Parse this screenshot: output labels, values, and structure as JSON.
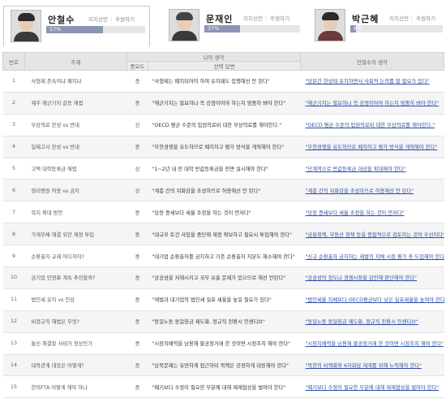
{
  "candidates": [
    {
      "name": "안철수",
      "support_btn": "지지선언",
      "donate_btn": "후원하기",
      "percent": "57%",
      "value": 0.57,
      "active": true
    },
    {
      "name": "문재인",
      "support_btn": "지지선언",
      "donate_btn": "후원하기",
      "percent": "37%",
      "value": 0.37,
      "active": false
    },
    {
      "name": "박근혜",
      "support_btn": "지지선언",
      "donate_btn": "후원하기",
      "percent": "6%",
      "value": 0.06,
      "active": false
    }
  ],
  "table": {
    "headers": {
      "no": "번호",
      "topic": "주제",
      "my_view": "나의 생각",
      "importance": "중요도",
      "answer": "선택 답변",
      "cand_view": "안철수의 생각"
    },
    "rows": [
      {
        "no": "1",
        "topic": "사형제 존속이냐 폐지냐",
        "imp": "중",
        "answer": "\"사형제는 폐지되어야 하며 유지돼도 집행해선 안 된다\"",
        "cand": "\"당분간 현상태 유지하면서 사회적 논의를 할 필요가 있다\""
      },
      {
        "no": "2",
        "topic": "제주 해군기지 갈등 해법",
        "imp": "중",
        "answer": "\"해군기지는 필요하나 꼭 강정이어야 하는지 엄중히 봐야 한다\"",
        "cand": "\"해군기지는 필요하나 꼭 강정이어야 하는지 엄중히 봐야 한다\""
      },
      {
        "no": "3",
        "topic": "무상의료 찬성 vs 반대",
        "imp": "상",
        "answer": "\"OECD 평균 수준의 입원의료비 대한 무상의료를 해야한다.\"",
        "cand": "\"OECD 평균 수준의 입원의료비 대한 무상의료를 해야한다.\""
      },
      {
        "no": "4",
        "topic": "일제고사 찬성 vs 반대",
        "imp": "중",
        "answer": "\"무한경쟁을 유도하므로 폐지하고 평가 방식을 개혁해야 한다\"",
        "cand": "\"무한경쟁을 유도하므로 폐지하고 평가 방식을 개혁해야 한다\""
      },
      {
        "no": "5",
        "topic": "고액 대학등록금 해법",
        "imp": "상",
        "answer": "\"1~2년 내 전 대학 반값등록금을 전면 실시해야 한다\"",
        "cand": "\"단계적으로 반값등록금 대상을 확대해야 한다\""
      },
      {
        "no": "6",
        "topic": "영리병원 허용 vs 금지",
        "imp": "상",
        "answer": "\"계층 간의 위화감을 조성하므로 허용해선 안 된다\"",
        "cand": "\"계층 간의 위화감을 조성하므로 허용해선 안 된다\""
      },
      {
        "no": "7",
        "topic": "복지 확대 방안",
        "imp": "중",
        "answer": "\"당장 증세보다 세율 조정을 하는 것이 먼저다\"",
        "cand": "\"당장 증세보다 세율 조정을 하는 것이 먼저다\""
      },
      {
        "no": "8",
        "topic": "가계부채 해결 위한 재정 투입",
        "imp": "중",
        "answer": "\"대규모 토건 사업을 중단해 재정 확보하고 필요시 투입해야 한다\"",
        "cand": "\"금융정책, 부동산 정책 등을 종합적으로 검토하는 것이 우선이다\""
      },
      {
        "no": "9",
        "topic": "순환출자 규제 어디까지?",
        "imp": "중",
        "answer": "\"대기업 순환출자를 금지하고 기존 순환출자 지분도 해소해야 한다\"",
        "cand": "\"신규 순환출자 금지하는 제벌의 지배 시점 평가 후 도입해야 한다\""
      },
      {
        "no": "10",
        "topic": "공기업 민영화 계속 추진할까?",
        "imp": "중",
        "answer": "\"공공성을 저해시키고 국부 유출 문제가 있으므로 해선 안된다\"",
        "cand": "\"공공성의 정도나 경쟁시장을 감안해 판단해야 한다\""
      },
      {
        "no": "11",
        "topic": "법인세 유지 vs 인상",
        "imp": "중",
        "answer": "\"재벌과 대기업의 법인세 실효 세율을 높일 필요가 있다\"",
        "cand": "\"법인세율 지체보다 OECD평균보다 낮은 실효세율을 높여야 한다\""
      },
      {
        "no": "12",
        "topic": "비정규직 해법은 무엇?",
        "imp": "중",
        "answer": "\"동일노동 동일임금 제도화, 정규직 전환시 인센티브\"",
        "cand": "\"동일노동 동일임금 제도화, 정규직 전환시 인센티브\""
      },
      {
        "no": "13",
        "topic": "통신 해결할 사태가 정상인가",
        "imp": "중",
        "answer": "\"시장지배력을 남용해 불공정거래 한 것이면 시정조치 해야 한다\"",
        "cand": "\"시장지배력을 남용해 불공정거래 한 것이면 시정조치 해야 한다\""
      },
      {
        "no": "14",
        "topic": "대북관계 대응은 어떻게?",
        "imp": "중",
        "answer": "\"남북문제는 유연하게 접근하되 북핵은 강경하게 대응해야 한다\"",
        "cand": "\"북한의 비핵화와 6자회담 재개를 위해 노력해야 한다\""
      },
      {
        "no": "15",
        "topic": "한미FTA 어떻게 해야 하나",
        "imp": "중",
        "answer": "\"폐기보다 수정이 필요한 부분에 대해 재재협상을 벌여야 한다\"",
        "cand": "\"폐기보다 수정이 필요한 부분에 대해 재재협상을 벌여야 한다\""
      }
    ]
  }
}
